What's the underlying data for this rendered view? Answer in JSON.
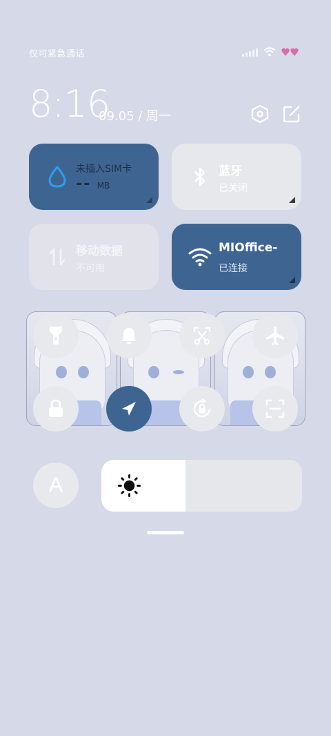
{
  "status_bar": {
    "carrier_text": "仅可紧急通话",
    "icons": [
      "signal-icon",
      "wifi-icon",
      "heart-icon",
      "heart-icon"
    ]
  },
  "header": {
    "time": "8:16",
    "date": "09.05 / 周一",
    "icons": [
      "settings-icon",
      "edit-icon"
    ]
  },
  "tiles": {
    "data_usage": {
      "title": "未插入SIM卡",
      "value": "--",
      "unit": "MB",
      "state": "on"
    },
    "bluetooth": {
      "title": "蓝牙",
      "status": "已关闭",
      "state": "off"
    },
    "mobile_data": {
      "title": "移动数据",
      "status": "不可用",
      "state": "disabled"
    },
    "wifi": {
      "title": "MIOffice-",
      "status": "已连接",
      "state": "on"
    }
  },
  "toggles": [
    {
      "icon": "flashlight-icon",
      "active": false
    },
    {
      "icon": "bell-icon",
      "active": false
    },
    {
      "icon": "screenshot-icon",
      "active": false
    },
    {
      "icon": "airplane-icon",
      "active": false
    },
    {
      "icon": "lock-icon",
      "active": false
    },
    {
      "icon": "location-icon",
      "active": true
    },
    {
      "icon": "rotation-lock-icon",
      "active": false
    },
    {
      "icon": "scan-icon",
      "active": false
    }
  ],
  "brightness": {
    "auto_label": "A",
    "level_fraction": 0.42
  },
  "colors": {
    "background": "#d5d9e8",
    "tile_active": "#3e6592",
    "tile_inactive": "#e7e8ec",
    "heart": "#d46fa8"
  }
}
